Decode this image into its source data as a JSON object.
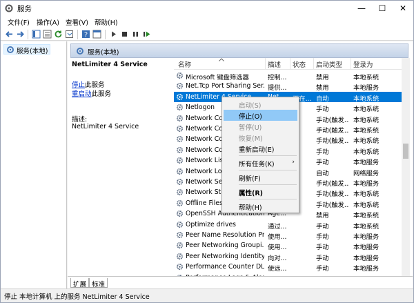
{
  "window": {
    "title": "服务",
    "controls": [
      "—",
      "☐",
      "✕"
    ]
  },
  "menu": [
    "文件(F)",
    "操作(A)",
    "查看(V)",
    "帮助(H)"
  ],
  "tree": {
    "root": "服务(本地)"
  },
  "pane_header": "服务(本地)",
  "detail": {
    "service_name": "NetLimiter 4 Service",
    "stop_link": "停止",
    "stop_suffix": "此服务",
    "restart_link": "重启动",
    "restart_suffix": "此服务",
    "desc_label": "描述:",
    "desc_value": "NetLimiter 4 Service"
  },
  "columns": [
    "名称",
    "描述",
    "状态",
    "启动类型",
    "登录为"
  ],
  "rows": [
    {
      "name": "Microsoft 键盘筛选器",
      "desc": "控制...",
      "status": "",
      "startup": "禁用",
      "logon": "本地系统"
    },
    {
      "name": "Net.Tcp Port Sharing Ser...",
      "desc": "提供...",
      "status": "",
      "startup": "禁用",
      "logon": "本地服务"
    },
    {
      "name": "NetLimiter 4 Service",
      "desc": "Net...",
      "status": "正在...",
      "startup": "自动",
      "logon": "本地系统"
    },
    {
      "name": "Netlogon",
      "desc": "",
      "status": "",
      "startup": "手动",
      "logon": "本地系统"
    },
    {
      "name": "Network Co",
      "desc": "",
      "status": "",
      "startup": "手动(触发...",
      "logon": "本地系统"
    },
    {
      "name": "Network Co",
      "desc": "",
      "status": "",
      "startup": "手动(触发...",
      "logon": "本地系统"
    },
    {
      "name": "Network Co",
      "desc": "",
      "status": "",
      "startup": "手动(触发...",
      "logon": "本地系统"
    },
    {
      "name": "Network Co",
      "desc": "",
      "status": "",
      "startup": "手动",
      "logon": "本地系统"
    },
    {
      "name": "Network Lis",
      "desc": "",
      "status": "",
      "startup": "手动",
      "logon": "本地服务"
    },
    {
      "name": "Network Lo",
      "desc": "",
      "status": "",
      "startup": "自动",
      "logon": "网络服务"
    },
    {
      "name": "Network Se",
      "desc": "",
      "status": "",
      "startup": "手动(触发...",
      "logon": "本地服务"
    },
    {
      "name": "Network Sto",
      "desc": "",
      "status": "",
      "startup": "手动(触发...",
      "logon": "本地系统"
    },
    {
      "name": "Offline Files",
      "desc": "",
      "status": "",
      "startup": "手动(触发...",
      "logon": "本地系统"
    },
    {
      "name": "OpenSSH Authentication...",
      "desc": "Age...",
      "status": "",
      "startup": "禁用",
      "logon": "本地系统"
    },
    {
      "name": "Optimize drives",
      "desc": "通过...",
      "status": "",
      "startup": "手动",
      "logon": "本地系统"
    },
    {
      "name": "Peer Name Resolution Pr...",
      "desc": "使用...",
      "status": "",
      "startup": "手动",
      "logon": "本地服务"
    },
    {
      "name": "Peer Networking Groupi...",
      "desc": "使用...",
      "status": "",
      "startup": "手动",
      "logon": "本地服务"
    },
    {
      "name": "Peer Networking Identity...",
      "desc": "向对...",
      "status": "",
      "startup": "手动",
      "logon": "本地服务"
    },
    {
      "name": "Performance Counter DL...",
      "desc": "使远...",
      "status": "",
      "startup": "手动",
      "logon": "本地服务"
    },
    {
      "name": "Performance Logs & Aler...",
      "desc": "性能...",
      "status": "",
      "startup": "手动",
      "logon": "本地服务"
    }
  ],
  "context_menu": [
    {
      "label": "启动(S)",
      "disabled": true
    },
    {
      "label": "停止(O)",
      "disabled": false,
      "highlight": true
    },
    {
      "label": "暂停(U)",
      "disabled": true
    },
    {
      "label": "恢复(M)",
      "disabled": true
    },
    {
      "label": "重新启动(E)",
      "disabled": false
    },
    {
      "label": "所有任务(K)",
      "disabled": false,
      "submenu": true
    },
    {
      "label": "刷新(F)",
      "disabled": false
    },
    {
      "label": "属性(R)",
      "disabled": false,
      "bold": true
    },
    {
      "label": "帮助(H)",
      "disabled": false
    }
  ],
  "tabs": [
    "扩展",
    "标准"
  ],
  "status_text": "停止 本地计算机 上的服务 NetLimiter 4 Service",
  "colors": {
    "selection": "#0078d7",
    "menu_highlight": "#91c9f7",
    "link": "#0033cc"
  }
}
